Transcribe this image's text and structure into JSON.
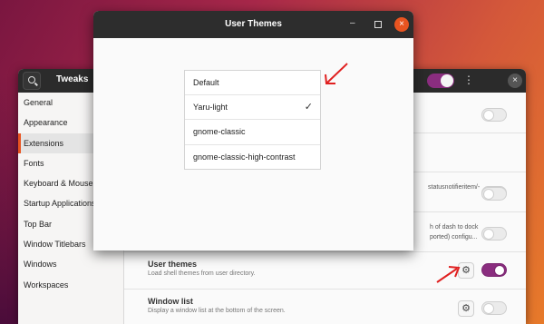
{
  "tweaks": {
    "title": "Tweaks",
    "close_glyph": "×",
    "menu_glyph": "⋮",
    "sidebar": [
      {
        "label": "General",
        "active": false
      },
      {
        "label": "Appearance",
        "active": false
      },
      {
        "label": "Extensions",
        "active": true
      },
      {
        "label": "Fonts",
        "active": false
      },
      {
        "label": "Keyboard & Mouse",
        "active": false
      },
      {
        "label": "Startup Applications",
        "active": false
      },
      {
        "label": "Top Bar",
        "active": false
      },
      {
        "label": "Window Titlebars",
        "active": false
      },
      {
        "label": "Windows",
        "active": false
      },
      {
        "label": "Workspaces",
        "active": false
      }
    ],
    "partial_texts": [
      "statusnotifieritem/-",
      "h of dash to dock",
      "ported) configu..."
    ],
    "user_themes": {
      "title": "User themes",
      "desc": "Load shell themes from user directory."
    },
    "window_list": {
      "title": "Window list",
      "desc": "Display a window list at the bottom of the screen."
    },
    "gear_glyph": "⚙"
  },
  "dialog": {
    "title": "User Themes",
    "min_glyph": "–",
    "close_glyph": "×",
    "themes": [
      {
        "label": "Default",
        "selected": false
      },
      {
        "label": "Yaru-light",
        "selected": true
      },
      {
        "label": "gnome-classic",
        "selected": false
      },
      {
        "label": "gnome-classic-high-contrast",
        "selected": false
      }
    ],
    "check_glyph": "✓"
  },
  "colors": {
    "accent_purple": "#8a2d7f",
    "accent_orange": "#e95420",
    "arrow_red": "#e02020"
  }
}
